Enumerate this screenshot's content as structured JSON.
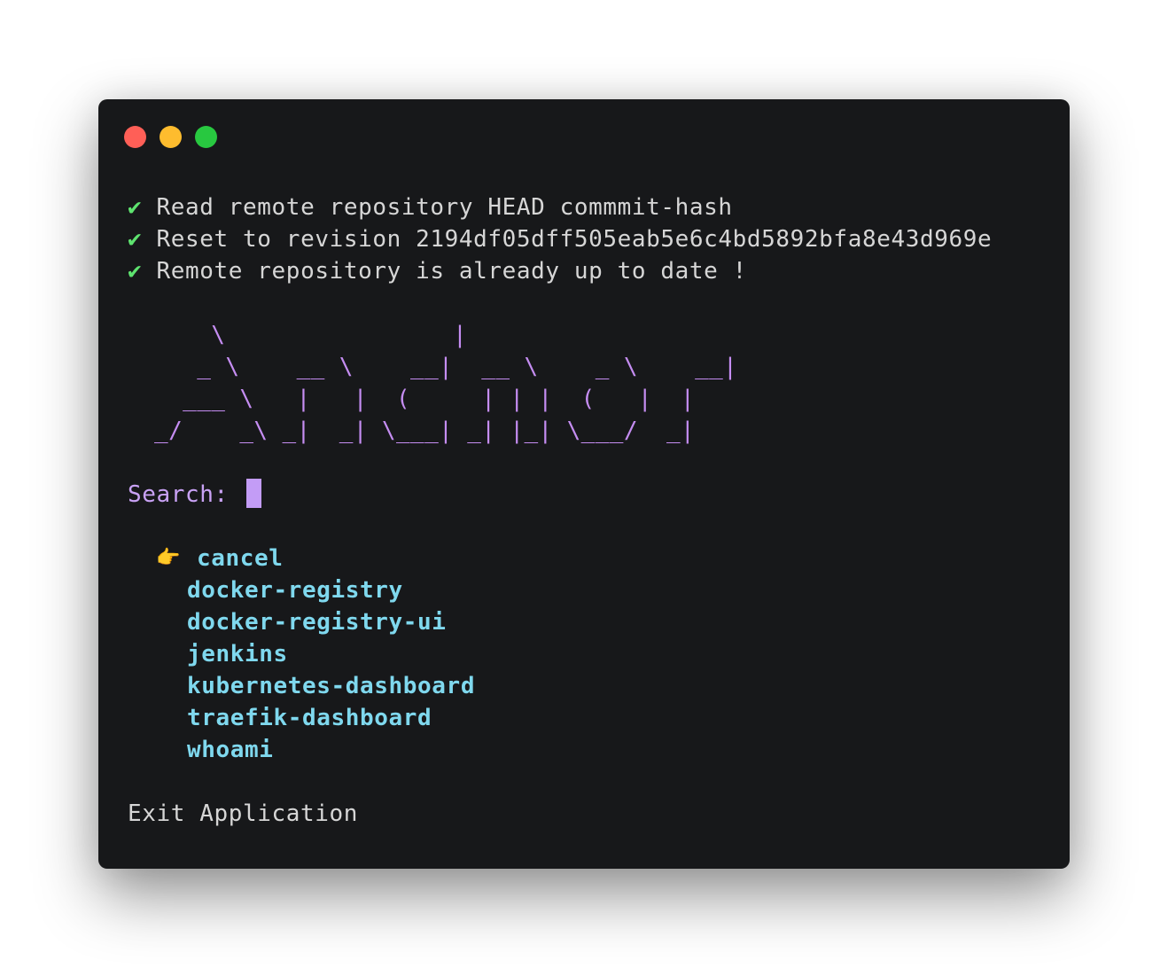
{
  "window": {
    "controls": [
      "close",
      "minimize",
      "maximize"
    ]
  },
  "log": [
    {
      "icon": "✔",
      "text": "Read remote repository HEAD commmit-hash"
    },
    {
      "icon": "✔",
      "text": "Reset to revision 2194df05dff505eab5e6c4bd5892bfa8e43d969e"
    },
    {
      "icon": "✔",
      "text": "Remote repository is already up to date !"
    }
  ],
  "banner": "     \\                |\n    _ \\    __ \\    __|  __ \\    _ \\    __|\n   ___ \\   |   |  (     | | |  (   |  |\n _/    _\\ _|  _| \\___| _| |_| \\___/  _|",
  "prompt": {
    "label": "Search:"
  },
  "menu": {
    "pointer": "👉",
    "items": [
      "cancel",
      "docker-registry",
      "docker-registry-ui",
      "jenkins",
      "kubernetes-dashboard",
      "traefik-dashboard",
      "whoami"
    ]
  },
  "footer": {
    "exit_label": "Exit Application"
  },
  "colors": {
    "background": "#17181a",
    "text": "#d6d6d6",
    "check": "#5ee36f",
    "banner": "#c58df2",
    "menu": "#7fd8ee",
    "cursor": "#c39cf6"
  }
}
